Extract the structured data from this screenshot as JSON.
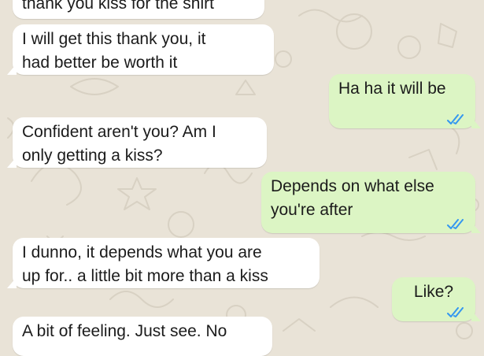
{
  "conversation": {
    "messages": [
      {
        "direction": "incoming",
        "text": "thank you kiss for the shirt"
      },
      {
        "direction": "incoming",
        "text": "I will get this thank you, it\nhad better be worth it"
      },
      {
        "direction": "outgoing",
        "text": "Ha ha it will be",
        "receipt": "read-receipt-icon"
      },
      {
        "direction": "incoming",
        "text": "Confident aren't you? Am I\nonly getting a kiss?"
      },
      {
        "direction": "outgoing",
        "text": "Depends on what else\nyou're after",
        "receipt": "read-receipt-icon"
      },
      {
        "direction": "incoming",
        "text": "I dunno, it depends what you are\nup for.. a little bit more than a kiss"
      },
      {
        "direction": "outgoing",
        "text": "Like?",
        "receipt": "read-receipt-icon"
      },
      {
        "direction": "incoming",
        "text": "A bit of feeling. Just see. No"
      }
    ]
  },
  "colors": {
    "background": "#e9e3d7",
    "incoming_bubble": "#ffffff",
    "outgoing_bubble": "#dcf5c4",
    "read_receipt": "#3497f0",
    "text": "#1b1b1b"
  }
}
